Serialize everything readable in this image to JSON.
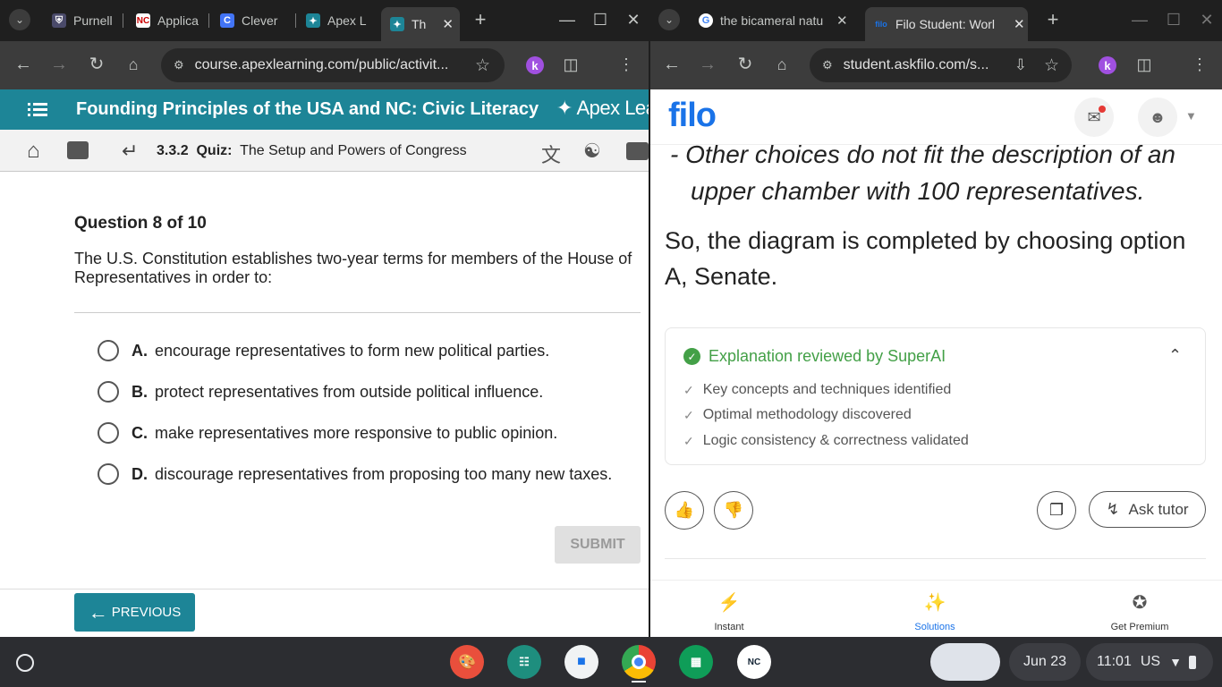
{
  "left_window": {
    "tabs": [
      {
        "title": "Purnell",
        "favicon": "shield-icon"
      },
      {
        "title": "Applica",
        "favicon": "NC"
      },
      {
        "title": "Clever",
        "favicon": "C"
      },
      {
        "title": "Apex L",
        "favicon": "apex-icon"
      },
      {
        "title": "Th",
        "favicon": "apex-icon"
      }
    ],
    "url": "course.apexlearning.com/public/activit..."
  },
  "apex": {
    "course_title": "Founding Principles of the USA and NC: Civic Literacy",
    "logo_text": "Apex Lea",
    "breadcrumb_num": "3.3.2",
    "breadcrumb_type": "Quiz:",
    "breadcrumb_title": "The Setup and Powers of Congress",
    "question_header": "Question 8 of 10",
    "question_text": "The U.S. Constitution establishes two-year terms for members of the House of Representatives in order to:",
    "options": [
      {
        "letter": "A.",
        "text": "encourage representatives to form new political parties."
      },
      {
        "letter": "B.",
        "text": "protect representatives from outside political influence."
      },
      {
        "letter": "C.",
        "text": "make representatives more responsive to public opinion."
      },
      {
        "letter": "D.",
        "text": "discourage representatives from proposing too many new taxes."
      }
    ],
    "submit_label": "SUBMIT",
    "previous_label": "PREVIOUS"
  },
  "right_window": {
    "tabs": [
      {
        "title": "the bicameral natu",
        "favicon": "G"
      },
      {
        "title": "Filo Student: Worl",
        "favicon": "filo"
      }
    ],
    "url": "student.askfilo.com/s..."
  },
  "filo": {
    "logo": "filo",
    "answer_line1": "- Other choices do not fit the description of an",
    "answer_line2": "upper chamber with 100 representatives.",
    "conclusion_line1": "So, the diagram is completed by choosing option",
    "conclusion_line2": "A, Senate.",
    "review_title": "Explanation reviewed by SuperAI",
    "checks": [
      "Key concepts and techniques identified",
      "Optimal methodology discovered",
      "Logic consistency & correctness validated"
    ],
    "ask_tutor_label": "Ask tutor",
    "nav": [
      {
        "label": "Instant"
      },
      {
        "label": "Solutions"
      },
      {
        "label": "Get Premium"
      }
    ]
  },
  "shelf": {
    "date": "Jun 23",
    "time": "11:01",
    "locale": "US"
  },
  "colors": {
    "apex_teal": "#1d8597",
    "filo_blue": "#1a73e8",
    "superai_green": "#43a047"
  }
}
